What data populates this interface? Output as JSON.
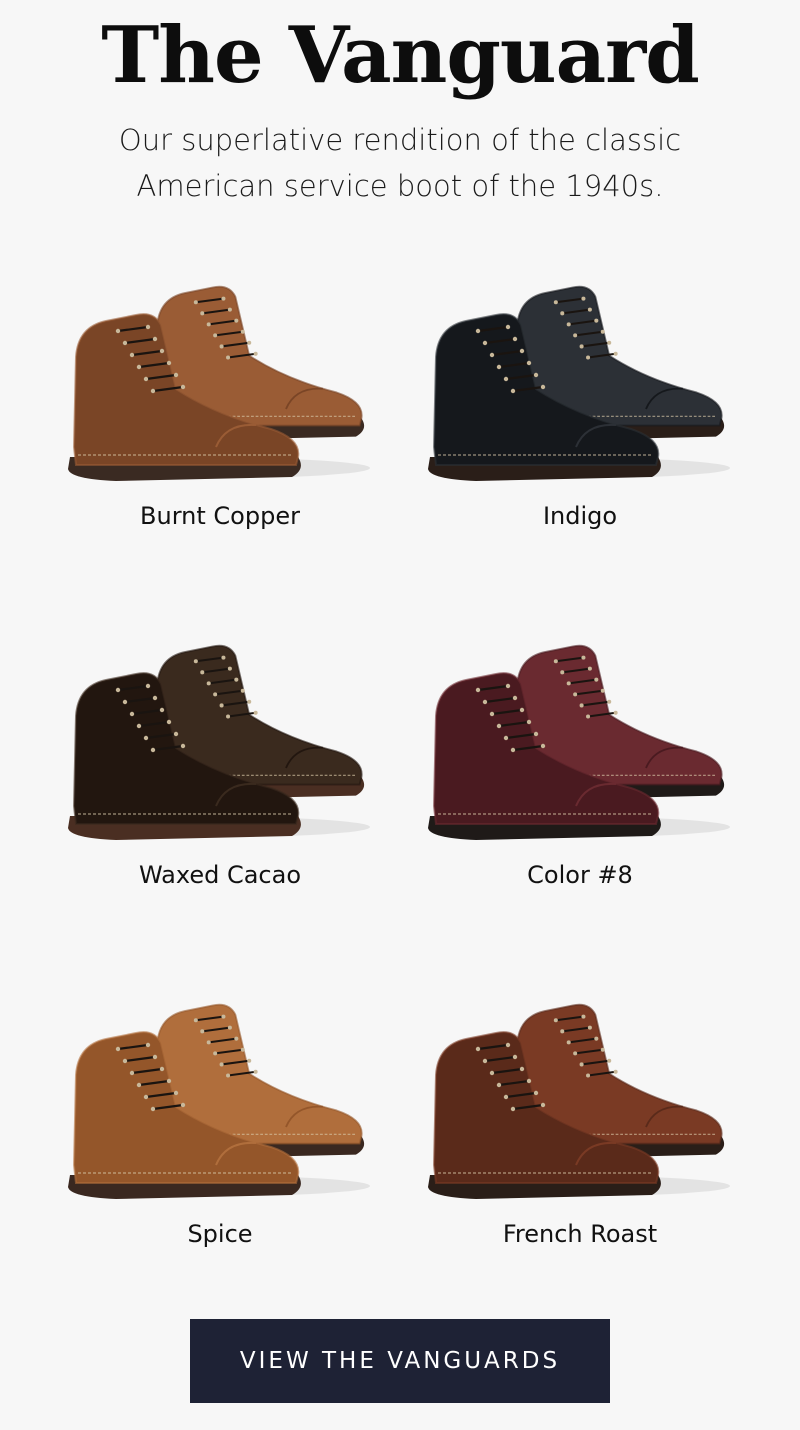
{
  "header": {
    "title": "The Vanguard",
    "subtitle": "Our superlative rendition of the classic American service boot of the 1940s."
  },
  "products": [
    {
      "name": "Burnt Copper",
      "image": "boot-image",
      "color": "#7a4526",
      "accent": "#9a5c35",
      "sole": "#3a2a22"
    },
    {
      "name": "Indigo",
      "image": "boot-image",
      "color": "#15181c",
      "accent": "#2c3036",
      "sole": "#2a1e18"
    },
    {
      "name": "Waxed Cacao",
      "image": "boot-image",
      "color": "#22160f",
      "accent": "#3a2a1e",
      "sole": "#4a2e22"
    },
    {
      "name": "Color #8",
      "image": "boot-image",
      "color": "#4a1a20",
      "accent": "#6a2a30",
      "sole": "#1f1a18"
    },
    {
      "name": "Spice",
      "image": "boot-image",
      "color": "#94562a",
      "accent": "#b06e3c",
      "sole": "#3a2820"
    },
    {
      "name": "French Roast",
      "image": "boot-image",
      "color": "#5a2a1a",
      "accent": "#7a3a24",
      "sole": "#2a1e18"
    }
  ],
  "cta": {
    "label": "VIEW THE VANGUARDS",
    "background": "#1e2235"
  },
  "colors": {
    "background": "#f7f7f7",
    "text": "#111111"
  }
}
